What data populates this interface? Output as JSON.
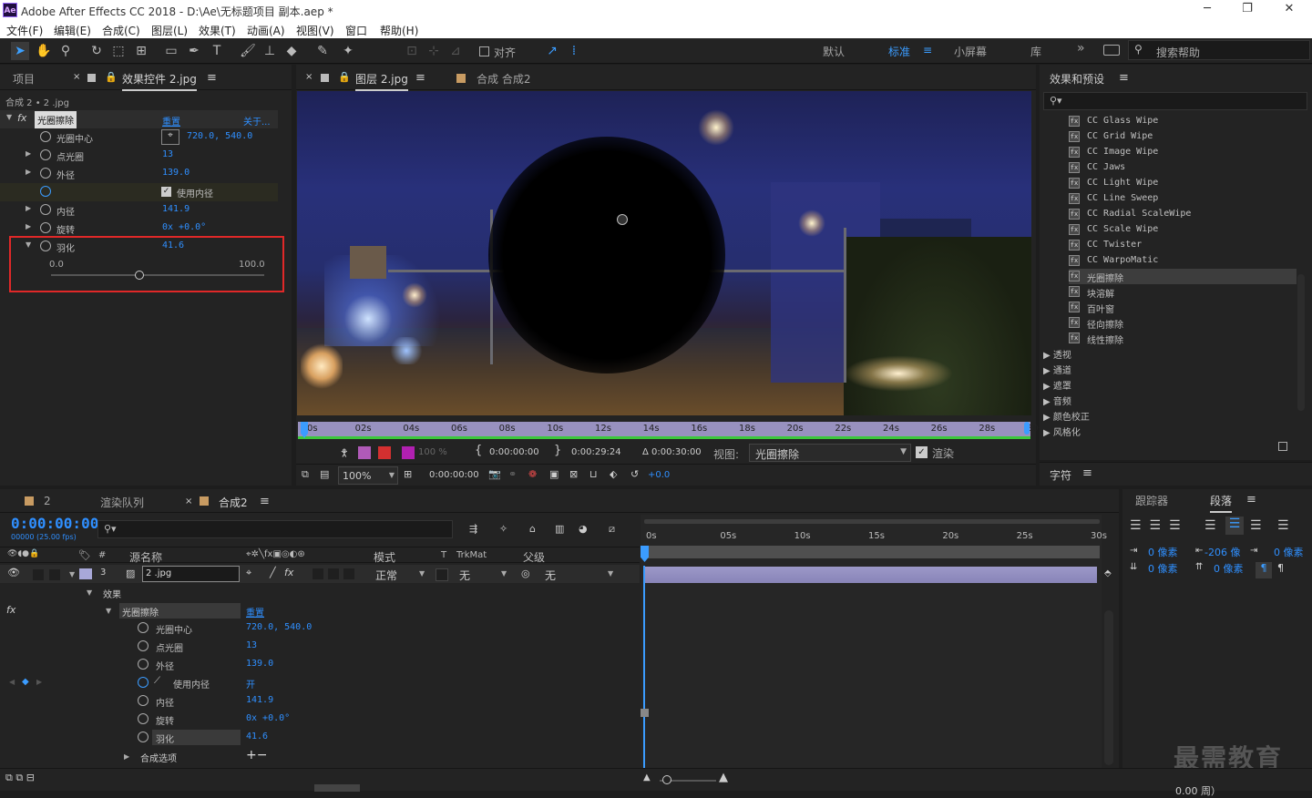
{
  "app": {
    "title": "Adobe After Effects CC 2018 - D:\\Ae\\无标题项目 副本.aep *",
    "logo": "Ae"
  },
  "window": {
    "minimize": "─",
    "restore": "❐",
    "close": "✕"
  },
  "menu": [
    "文件(F)",
    "编辑(E)",
    "合成(C)",
    "图层(L)",
    "效果(T)",
    "动画(A)",
    "视图(V)",
    "窗口",
    "帮助(H)"
  ],
  "toolbar": {
    "snap_label": "对齐",
    "workspaces": [
      "默认",
      "标准",
      "小屏幕",
      "库"
    ],
    "active_workspace": "标准",
    "search_placeholder": "搜索帮助",
    "more": "»"
  },
  "left_panel": {
    "tabs": [
      "项目",
      "效果控件 2.jpg"
    ],
    "breadcrumb": "合成 2 • 2 .jpg",
    "effect_name": "光圈擦除",
    "reset": "重置",
    "about": "关于...",
    "props": [
      {
        "name": "光圈中心",
        "value": "720.0, 540.0",
        "expand": false,
        "point": true
      },
      {
        "name": "点光圈",
        "value": "13",
        "expand": true
      },
      {
        "name": "外径",
        "value": "139.0",
        "expand": true
      },
      {
        "name": "",
        "value": "使用内径",
        "expand": false,
        "checkbox": true
      },
      {
        "name": "内径",
        "value": "141.9",
        "expand": true
      },
      {
        "name": "旋转",
        "value": "0x +0.0°",
        "expand": true
      },
      {
        "name": "羽化",
        "value": "41.6",
        "expand": true,
        "open": true
      }
    ],
    "slider": {
      "min": "0.0",
      "max": "100.0",
      "fraction": 0.416
    }
  },
  "viewer": {
    "tabs": [
      "图层 2.jpg",
      "合成 合成2"
    ],
    "ruler": [
      "0s",
      "02s",
      "04s",
      "06s",
      "08s",
      "10s",
      "12s",
      "14s",
      "16s",
      "18s",
      "20s",
      "22s",
      "24s",
      "26s",
      "28s",
      "30s"
    ],
    "zoom_pct": "100 %",
    "time_in": "0:00:00:00",
    "time_out": "0:00:29:24",
    "duration": "Δ 0:00:30:00",
    "view_label": "视图:",
    "view_value": "光圈擦除",
    "render_label": "渲染",
    "bottom": {
      "zoom": "100%",
      "time": "0:00:00:00",
      "exposure": "+0.0"
    }
  },
  "effects_panel": {
    "title": "效果和预设",
    "search_placeholder": "",
    "items": [
      "CC Glass Wipe",
      "CC Grid Wipe",
      "CC Image Wipe",
      "CC Jaws",
      "CC Light Wipe",
      "CC Line Sweep",
      "CC Radial ScaleWipe",
      "CC Scale Wipe",
      "CC Twister",
      "CC WarpoMatic",
      "光圈擦除",
      "块溶解",
      "百叶窗",
      "径向擦除",
      "线性擦除"
    ],
    "selected": "光圈擦除",
    "categories": [
      "透视",
      "通道",
      "遮罩",
      "音频",
      "颜色校正",
      "风格化"
    ]
  },
  "char_panel": {
    "title": "字符"
  },
  "timeline": {
    "tabs": [
      "2",
      "渲染队列",
      "合成2"
    ],
    "timecode": "0:00:00:00",
    "fps": "00000 (25.00 fps)",
    "col_headers": {
      "source": "源名称",
      "mode": "模式",
      "t": "T",
      "trkmat": "TrkMat",
      "parent": "父级",
      "num": "#"
    },
    "layer": {
      "num": "3",
      "name": "2 .jpg",
      "mode": "正常",
      "trkmat": "无",
      "parent": "无"
    },
    "effects_group": "效果",
    "effect": "光圈擦除",
    "reset": "重置",
    "props": [
      {
        "name": "光圈中心",
        "value": "720.0, 540.0"
      },
      {
        "name": "点光圈",
        "value": "13"
      },
      {
        "name": "外径",
        "value": "139.0"
      },
      {
        "name": "使用内径",
        "value": "开"
      },
      {
        "name": "内径",
        "value": "141.9"
      },
      {
        "name": "旋转",
        "value": "0x +0.0°"
      },
      {
        "name": "羽化",
        "value": "41.6"
      }
    ],
    "comp_options": "合成选项",
    "comp_options_ctrl": "+−",
    "ruler": [
      "0s",
      "05s",
      "10s",
      "15s",
      "20s",
      "25s",
      "30s"
    ]
  },
  "paragraph_panel": {
    "tabs": [
      "跟踪器",
      "段落"
    ],
    "rows": [
      [
        "0 像素",
        "-206 像",
        "0 像素"
      ],
      [
        "0 像素",
        "0 像素"
      ]
    ]
  },
  "watermark": "最需教育",
  "footer": {
    "fragment": "0.00 周）"
  }
}
